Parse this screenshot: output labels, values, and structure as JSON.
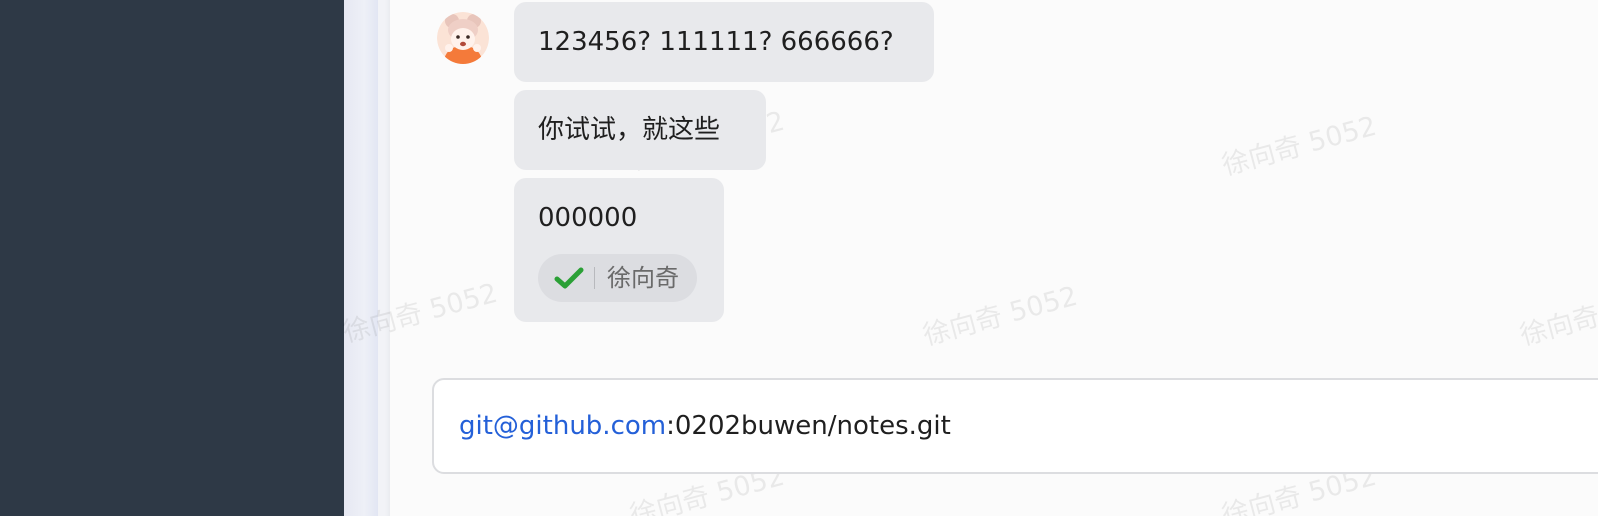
{
  "messages": [
    {
      "text": "123456?  111111?  666666?"
    },
    {
      "text": "你试试，就这些"
    },
    {
      "text": "000000",
      "read_by": "徐向奇"
    }
  ],
  "input": {
    "link_text": "git@github.com",
    "rest_text": ":0202buwen/notes.git"
  },
  "watermark": "徐向奇 5052",
  "colors": {
    "sidebar": "#2e3946",
    "bubble": "#e8e9ec",
    "link": "#2460d8",
    "check": "#2ba036"
  },
  "icons": {
    "avatar": "cartoon-avatar",
    "receipt": "check-icon"
  }
}
